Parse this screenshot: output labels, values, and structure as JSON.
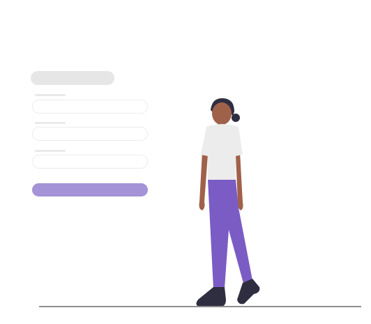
{
  "illustration": {
    "subject": "person-walking",
    "colors": {
      "accent": "#7b5cc4",
      "accent_light": "#a493d6",
      "placeholder_gray": "#e6e6e6",
      "shirt": "#ececec",
      "skin": "#a0614a",
      "hair": "#2f2e41",
      "shoes": "#2f2e41",
      "ground": "#8d8d8d"
    }
  },
  "form_mockup": {
    "fields": [
      {
        "label": "",
        "value": ""
      },
      {
        "label": "",
        "value": ""
      },
      {
        "label": "",
        "value": ""
      }
    ],
    "submit_label": ""
  }
}
